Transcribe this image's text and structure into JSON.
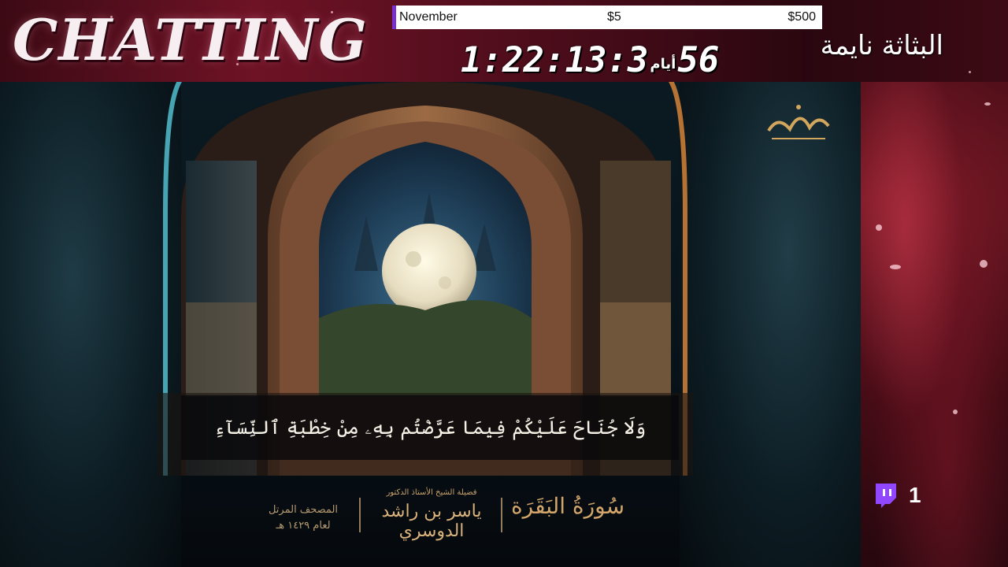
{
  "header": {
    "title": "CHATTING",
    "status_arabic": "البثاثة نايمة"
  },
  "goal": {
    "label": "November",
    "start": "$5",
    "target": "$500",
    "accent": "#7c2fd1"
  },
  "countdown": {
    "days": "56",
    "days_word": "أيام",
    "time": "1:22:13:3"
  },
  "video": {
    "ayah": "وَلَا جُنَاحَ عَلَيْكُمْ فِيمَا عَرَّضْتُم بِهِۦ مِنْ خِطْبَةِ ٱلنِّسَآءِ",
    "mushaf_line1": "المصحف المرتل",
    "mushaf_line2": "لعام ١٤٢٩ هـ",
    "reciter_title": "فضيلة الشيخ الأستاذ الدكتور",
    "reciter_name": "ياسر بن راشد الدوسري",
    "surah": "سُورَةُ البَقَرَة",
    "logo_icon": "calligraphy-logo"
  },
  "viewers": {
    "count": "1",
    "icon": "twitch-icon",
    "color": "#9146ff"
  }
}
